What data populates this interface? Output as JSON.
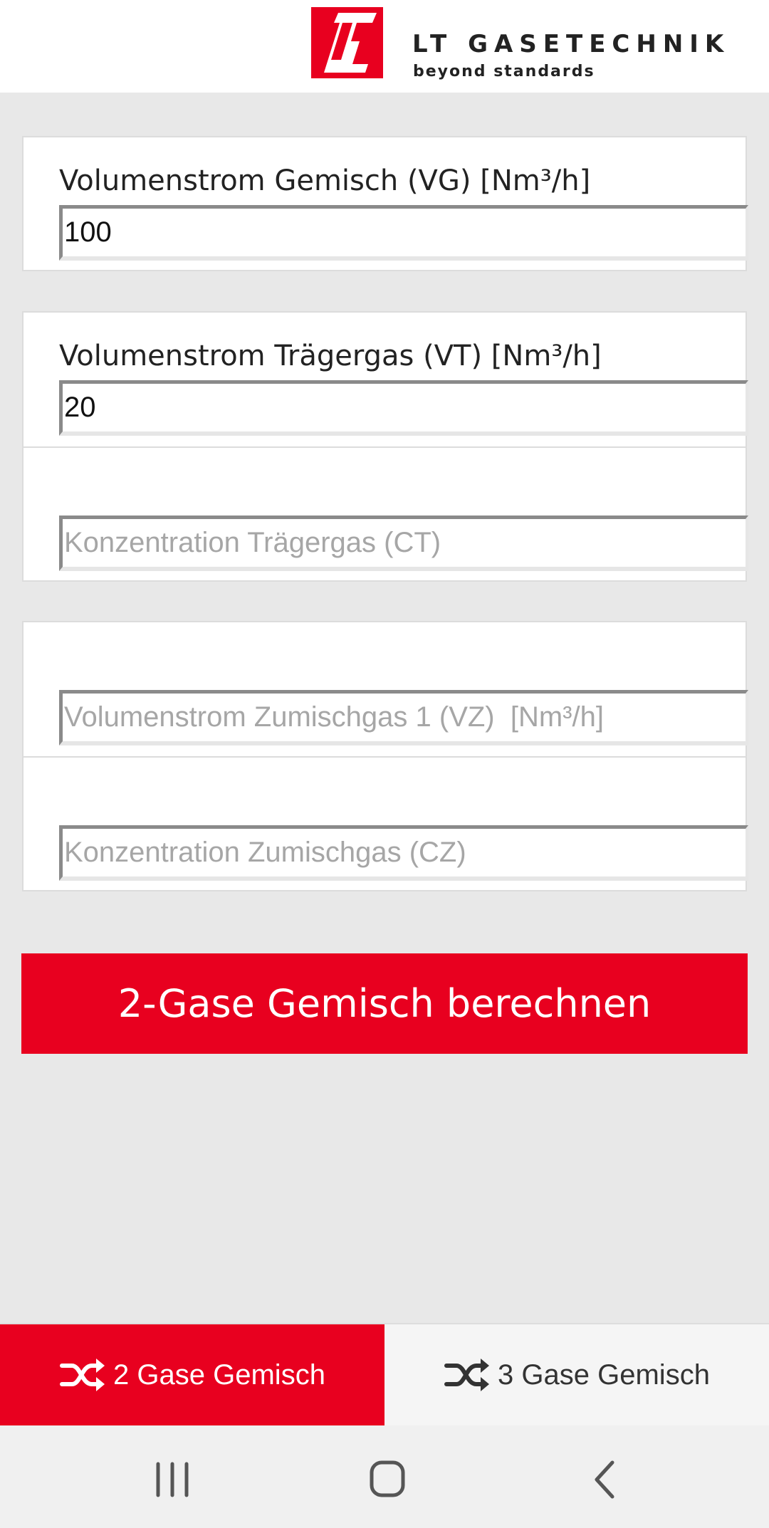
{
  "header": {
    "brand_name": "LT GASETECHNIK",
    "tagline": "beyond standards",
    "logo_letters": "LT"
  },
  "form": {
    "vg": {
      "label": "Volumenstrom Gemisch (VG) [Nm³/h]",
      "value": "100",
      "placeholder": ""
    },
    "vt": {
      "label": "Volumenstrom Trägergas (VT) [Nm³/h]",
      "value": "20",
      "placeholder": ""
    },
    "ct": {
      "label": "",
      "value": "",
      "placeholder": "Konzentration Trägergas (CT)"
    },
    "vz": {
      "label": "",
      "value": "",
      "placeholder": "Volumenstrom Zumischgas 1 (VZ)  [Nm³/h]"
    },
    "cz": {
      "label": "",
      "value": "",
      "placeholder": "Konzentration Zumischgas (CZ)"
    }
  },
  "calc_button": "2-Gase Gemisch berechnen",
  "tabs": [
    {
      "label": "2 Gase Gemisch",
      "icon": "shuffle-icon",
      "active": true
    },
    {
      "label": "3 Gase Gemisch",
      "icon": "shuffle-icon",
      "active": false
    }
  ],
  "colors": {
    "accent": "#e8001f",
    "background": "#e8e8e8"
  }
}
